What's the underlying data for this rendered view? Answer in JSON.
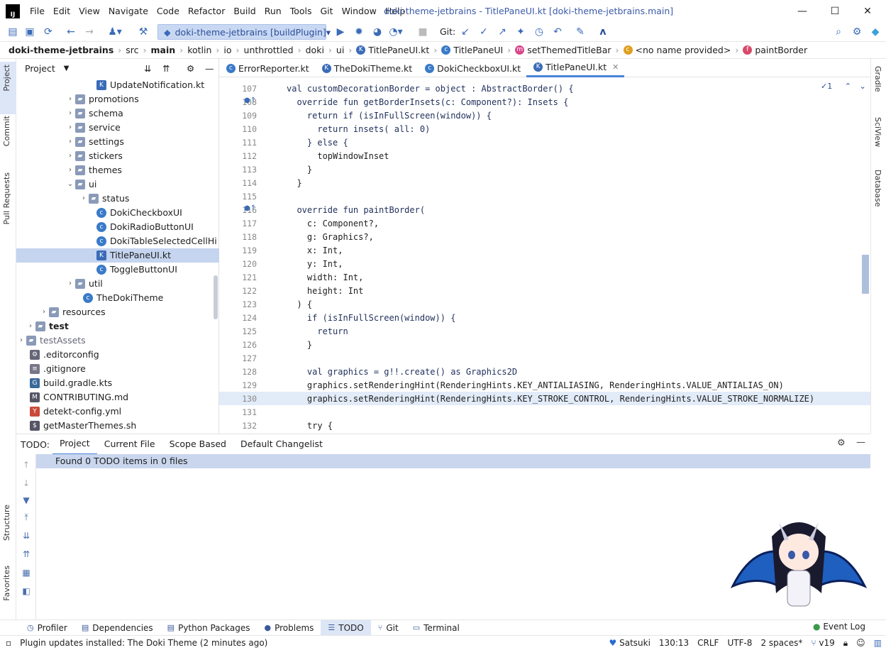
{
  "titlebar": {
    "menu": [
      "File",
      "Edit",
      "View",
      "Navigate",
      "Code",
      "Refactor",
      "Build",
      "Run",
      "Tools",
      "Git",
      "Window",
      "Help"
    ],
    "title": "doki-theme-jetbrains - TitlePaneUI.kt [doki-theme-jetbrains.main]",
    "minimize": "—",
    "maximize": "☐",
    "close": "✕"
  },
  "toolbar": {
    "run_config": "doki-theme-jetbrains [buildPlugin]",
    "git_label": "Git:"
  },
  "breadcrumbs": [
    "doki-theme-jetbrains",
    "src",
    "main",
    "kotlin",
    "io",
    "unthrottled",
    "doki",
    "ui",
    "TitlePaneUI.kt",
    "TitlePaneUI",
    "setThemedTitleBar",
    "<no name provided>",
    "paintBorder"
  ],
  "left_strip": {
    "project": "Project",
    "commit": "Commit",
    "pull_requests": "Pull Requests",
    "structure": "Structure",
    "favorites": "Favorites"
  },
  "right_strip": {
    "gradle": "Gradle",
    "sciview": "SciView",
    "database": "Database"
  },
  "project_panel": {
    "title": "Project",
    "tree": [
      {
        "label": "UpdateNotification.kt",
        "type": "kotlin",
        "arrow": ""
      },
      {
        "label": "promotions",
        "type": "folder",
        "arrow": "›"
      },
      {
        "label": "schema",
        "type": "folder",
        "arrow": "›"
      },
      {
        "label": "service",
        "type": "folder",
        "arrow": "›"
      },
      {
        "label": "settings",
        "type": "folder",
        "arrow": "›"
      },
      {
        "label": "stickers",
        "type": "folder",
        "arrow": "›"
      },
      {
        "label": "themes",
        "type": "folder",
        "arrow": "›"
      },
      {
        "label": "ui",
        "type": "folder",
        "arrow": "⌄"
      },
      {
        "label": "status",
        "type": "folder",
        "arrow": "›"
      },
      {
        "label": "DokiCheckboxUI",
        "type": "class",
        "arrow": ""
      },
      {
        "label": "DokiRadioButtonUI",
        "type": "class",
        "arrow": ""
      },
      {
        "label": "DokiTableSelectedCellHi",
        "type": "class",
        "arrow": ""
      },
      {
        "label": "TitlePaneUI.kt",
        "type": "kotlin",
        "arrow": ""
      },
      {
        "label": "ToggleButtonUI",
        "type": "class",
        "arrow": ""
      },
      {
        "label": "util",
        "type": "folder",
        "arrow": "›"
      },
      {
        "label": "TheDokiTheme",
        "type": "class",
        "arrow": ""
      },
      {
        "label": "resources",
        "type": "folder",
        "arrow": "›"
      },
      {
        "label": "test",
        "type": "folder",
        "arrow": "›"
      },
      {
        "label": "testAssets",
        "type": "folder",
        "arrow": "›"
      },
      {
        "label": ".editorconfig",
        "type": "config",
        "arrow": ""
      },
      {
        "label": ".gitignore",
        "type": "text",
        "arrow": ""
      },
      {
        "label": "build.gradle.kts",
        "type": "gradle",
        "arrow": ""
      },
      {
        "label": "CONTRIBUTING.md",
        "type": "md",
        "arrow": ""
      },
      {
        "label": "detekt-config.yml",
        "type": "yml",
        "arrow": ""
      },
      {
        "label": "getMasterThemes.sh",
        "type": "sh",
        "arrow": ""
      }
    ]
  },
  "editor_tabs": [
    {
      "label": "ErrorReporter.kt",
      "active": false
    },
    {
      "label": "TheDokiTheme.kt",
      "active": false
    },
    {
      "label": "DokiCheckboxUI.kt",
      "active": false
    },
    {
      "label": "TitlePaneUI.kt",
      "active": true
    }
  ],
  "editor": {
    "inspection_count": "1",
    "lines": [
      {
        "n": "107",
        "code": "val customDecorationBorder = object : AbstractBorder() {"
      },
      {
        "n": "108",
        "code": "  override fun getBorderInsets(c: Component?): Insets {"
      },
      {
        "n": "109",
        "code": "    return if (isInFullScreen(window)) {"
      },
      {
        "n": "110",
        "code": "      return insets( all: 0)"
      },
      {
        "n": "111",
        "code": "    } else {"
      },
      {
        "n": "112",
        "code": "      topWindowInset"
      },
      {
        "n": "113",
        "code": "    }"
      },
      {
        "n": "114",
        "code": "  }"
      },
      {
        "n": "115",
        "code": ""
      },
      {
        "n": "116",
        "code": "  override fun paintBorder("
      },
      {
        "n": "117",
        "code": "    c: Component?,"
      },
      {
        "n": "118",
        "code": "    g: Graphics?,"
      },
      {
        "n": "119",
        "code": "    x: Int,"
      },
      {
        "n": "120",
        "code": "    y: Int,"
      },
      {
        "n": "121",
        "code": "    width: Int,"
      },
      {
        "n": "122",
        "code": "    height: Int"
      },
      {
        "n": "123",
        "code": "  ) {"
      },
      {
        "n": "124",
        "code": "    if (isInFullScreen(window)) {"
      },
      {
        "n": "125",
        "code": "      return"
      },
      {
        "n": "126",
        "code": "    }"
      },
      {
        "n": "127",
        "code": ""
      },
      {
        "n": "128",
        "code": "    val graphics = g!!.create() as Graphics2D"
      },
      {
        "n": "129",
        "code": "    graphics.setRenderingHint(RenderingHints.KEY_ANTIALIASING, RenderingHints.VALUE_ANTIALIAS_ON)"
      },
      {
        "n": "130",
        "code": "    graphics.setRenderingHint(RenderingHints.KEY_STROKE_CONTROL, RenderingHints.VALUE_STROKE_NORMALIZE)"
      },
      {
        "n": "131",
        "code": ""
      },
      {
        "n": "132",
        "code": "    try {"
      }
    ]
  },
  "todo_panel": {
    "label": "TODO:",
    "tabs": [
      "Project",
      "Current File",
      "Scope Based",
      "Default Changelist"
    ],
    "message": "Found 0 TODO items in 0 files"
  },
  "tool_windows": [
    "Profiler",
    "Dependencies",
    "Python Packages",
    "Problems",
    "TODO",
    "Git",
    "Terminal"
  ],
  "event_log": "Event Log",
  "status": {
    "message": "Plugin updates installed: The Doki Theme (2 minutes ago)",
    "theme": "Satsuki",
    "position": "130:13",
    "line_sep": "CRLF",
    "encoding": "UTF-8",
    "indent": "2 spaces*",
    "version": "v19"
  },
  "colors": {
    "accent": "#4a83d8",
    "selection": "#c5d4ef",
    "keyword": "#2a4a9a"
  }
}
